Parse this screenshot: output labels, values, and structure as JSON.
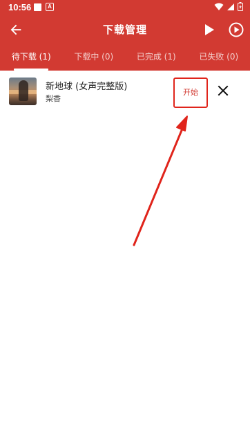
{
  "status_bar": {
    "time": "10:56",
    "badge": "A",
    "icons": [
      "square-icon",
      "a-badge-icon",
      "wifi-icon",
      "signal-icon",
      "battery-icon"
    ]
  },
  "toolbar": {
    "title": "下载管理",
    "icons": [
      "back-arrow-icon",
      "play-icon",
      "play-circle-icon"
    ]
  },
  "tabs": [
    {
      "label": "待下载 (1)",
      "active": true
    },
    {
      "label": "下载中 (0)",
      "active": false
    },
    {
      "label": "已完成 (1)",
      "active": false
    },
    {
      "label": "已失败 (0)",
      "active": false
    }
  ],
  "downloads": [
    {
      "title": "新地球 (女声完整版)",
      "artist": "梨香",
      "action_label": "开始",
      "icons": [
        "album-thumbnail",
        "close-icon"
      ]
    }
  ],
  "colors": {
    "primary": "#d23a32",
    "annotation": "#e0241b",
    "text": "#222222"
  }
}
